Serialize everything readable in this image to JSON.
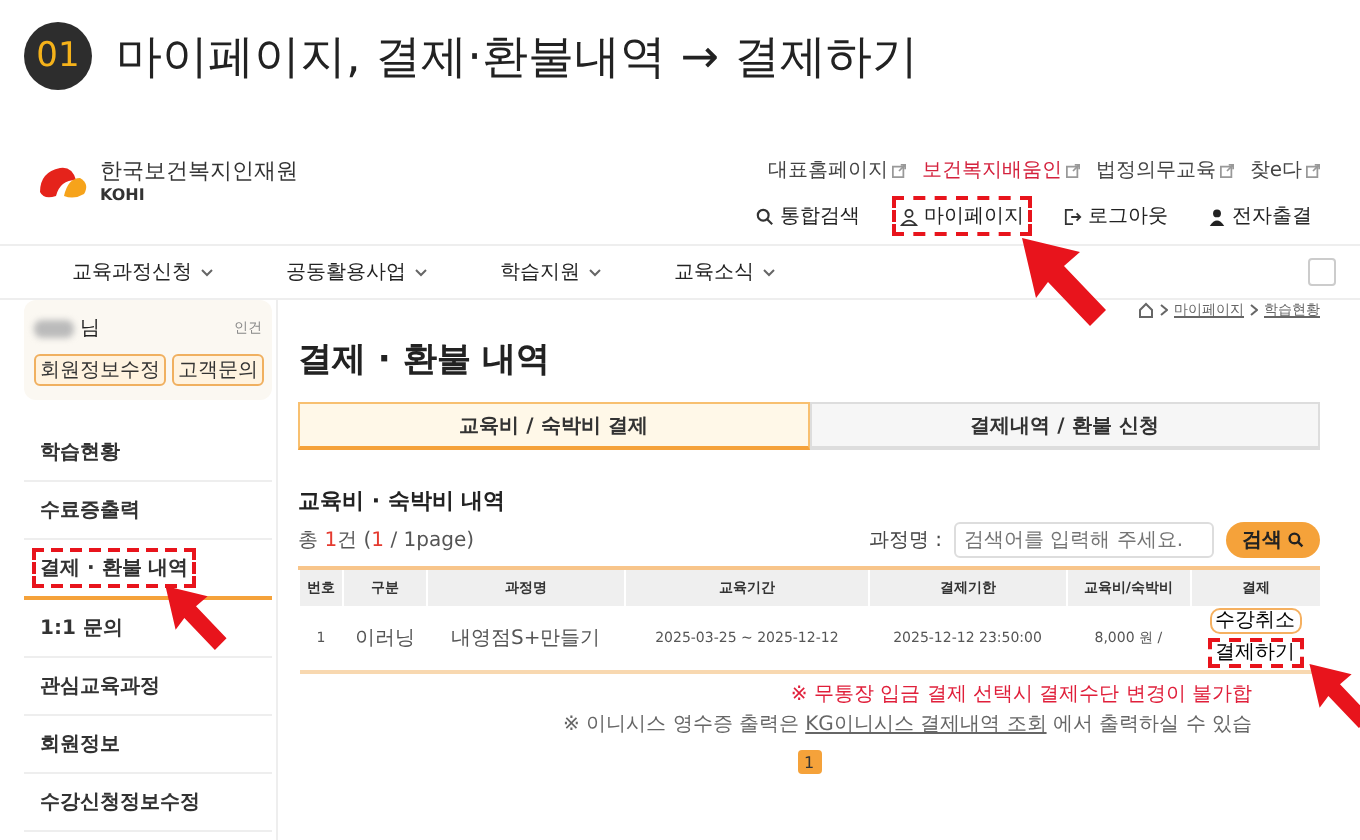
{
  "banner": {
    "step": "01",
    "title": "마이페이지, 결제·환불내역 → 결제하기"
  },
  "logo": {
    "name": "한국보건복지인재원",
    "abbr": "KOHI"
  },
  "top_links": [
    {
      "label": "대표홈페이지",
      "accent": false
    },
    {
      "label": "보건복지배움인",
      "accent": true
    },
    {
      "label": "법정의무교육",
      "accent": false
    },
    {
      "label": "찾e다",
      "accent": false
    }
  ],
  "utility_links": [
    {
      "label": "통합검색",
      "kind": "search",
      "highlighted": false
    },
    {
      "label": "마이페이지",
      "kind": "account",
      "highlighted": true
    },
    {
      "label": "로그아웃",
      "kind": "logout",
      "highlighted": false
    },
    {
      "label": "전자출결",
      "kind": "attendance",
      "highlighted": false
    }
  ],
  "nav": [
    "교육과정신청",
    "공동활용사업",
    "학습지원",
    "교육소식"
  ],
  "breadcrumb": [
    "마이페이지",
    "학습현황"
  ],
  "user_card": {
    "suffix": "님",
    "status": "인건",
    "buttons": [
      "회원정보수정",
      "고객문의"
    ]
  },
  "sidebar": {
    "items": [
      {
        "label": "학습현황",
        "selected": false,
        "highlighted": false
      },
      {
        "label": "수료증출력",
        "selected": false,
        "highlighted": false
      },
      {
        "label": "결제 · 환불 내역",
        "selected": true,
        "highlighted": true
      },
      {
        "label": "1:1 문의",
        "selected": false,
        "highlighted": false
      },
      {
        "label": "관심교육과정",
        "selected": false,
        "highlighted": false
      },
      {
        "label": "회원정보",
        "selected": false,
        "highlighted": false
      },
      {
        "label": "수강신청정보수정",
        "selected": false,
        "highlighted": false
      }
    ]
  },
  "page_title": "결제 · 환불 내역",
  "tabs": [
    {
      "label": "교육비 / 숙박비 결제",
      "selected": true
    },
    {
      "label": "결제내역 / 환불 신청",
      "selected": false
    }
  ],
  "section_title": "교육비 · 숙박비 내역",
  "count": [
    {
      "text": "총 ",
      "accent": false
    },
    {
      "text": "1",
      "accent": true
    },
    {
      "text": "건 (",
      "accent": false
    },
    {
      "text": "1",
      "accent": true
    },
    {
      "text": " / 1page)",
      "accent": false
    }
  ],
  "search": {
    "label": "과정명 :",
    "placeholder": "검색어를 입력해 주세요.",
    "button": "검색"
  },
  "table": {
    "columns": [
      "번호",
      "구분",
      "과정명",
      "교육기간",
      "결제기한",
      "교육비/숙박비",
      "결제"
    ],
    "rows": [
      {
        "cells": [
          "1",
          "이러닝",
          "내영점S+만들기",
          "2025-03-25 ~ 2025-12-12",
          "2025-12-12 23:50:00",
          "8,000 원 /"
        ],
        "actions": [
          {
            "label": "수강취소",
            "highlighted": false
          },
          {
            "label": "결제하기",
            "highlighted": true
          }
        ]
      }
    ]
  },
  "notes": [
    {
      "kind": "warning",
      "before": "※ 무통장 입금 결제 선택시 결제수단 변경이 불가합"
    },
    {
      "kind": "info",
      "before": "※ 이니시스 영수증 출력은 ",
      "link": "KG이니시스 결제내역 조회",
      "after": " 에서 출력하실 수 있습"
    }
  ],
  "pagination": [
    {
      "label": "1",
      "selected": true
    }
  ]
}
